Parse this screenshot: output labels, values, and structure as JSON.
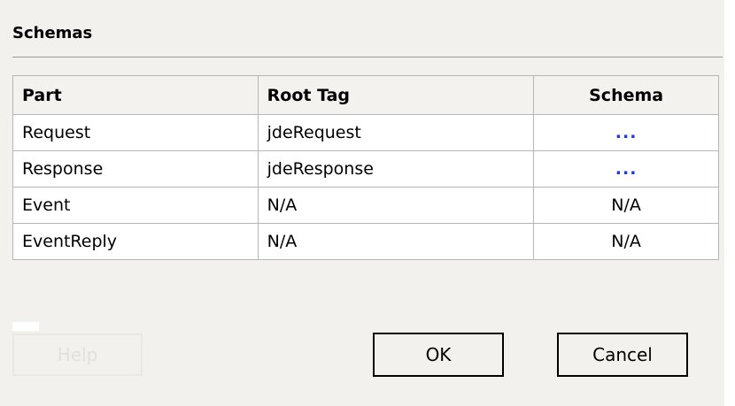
{
  "section": {
    "title": "Schemas"
  },
  "table": {
    "headers": [
      "Part",
      "Root Tag",
      "Schema"
    ],
    "rows": [
      {
        "part": "Request",
        "root_tag": "jdeRequest",
        "schema": "..."
      },
      {
        "part": "Response",
        "root_tag": "jdeResponse",
        "schema": "..."
      },
      {
        "part": "Event",
        "root_tag": "N/A",
        "schema": "N/A"
      },
      {
        "part": "EventReply",
        "root_tag": "N/A",
        "schema": "N/A"
      }
    ]
  },
  "buttons": {
    "help_label": "Help",
    "ok_label": "OK",
    "cancel_label": "Cancel"
  },
  "colors": {
    "dialog_bg": "#f3f1ee",
    "link": "#1d3ddf",
    "disabled_text": "#e3e0db"
  }
}
